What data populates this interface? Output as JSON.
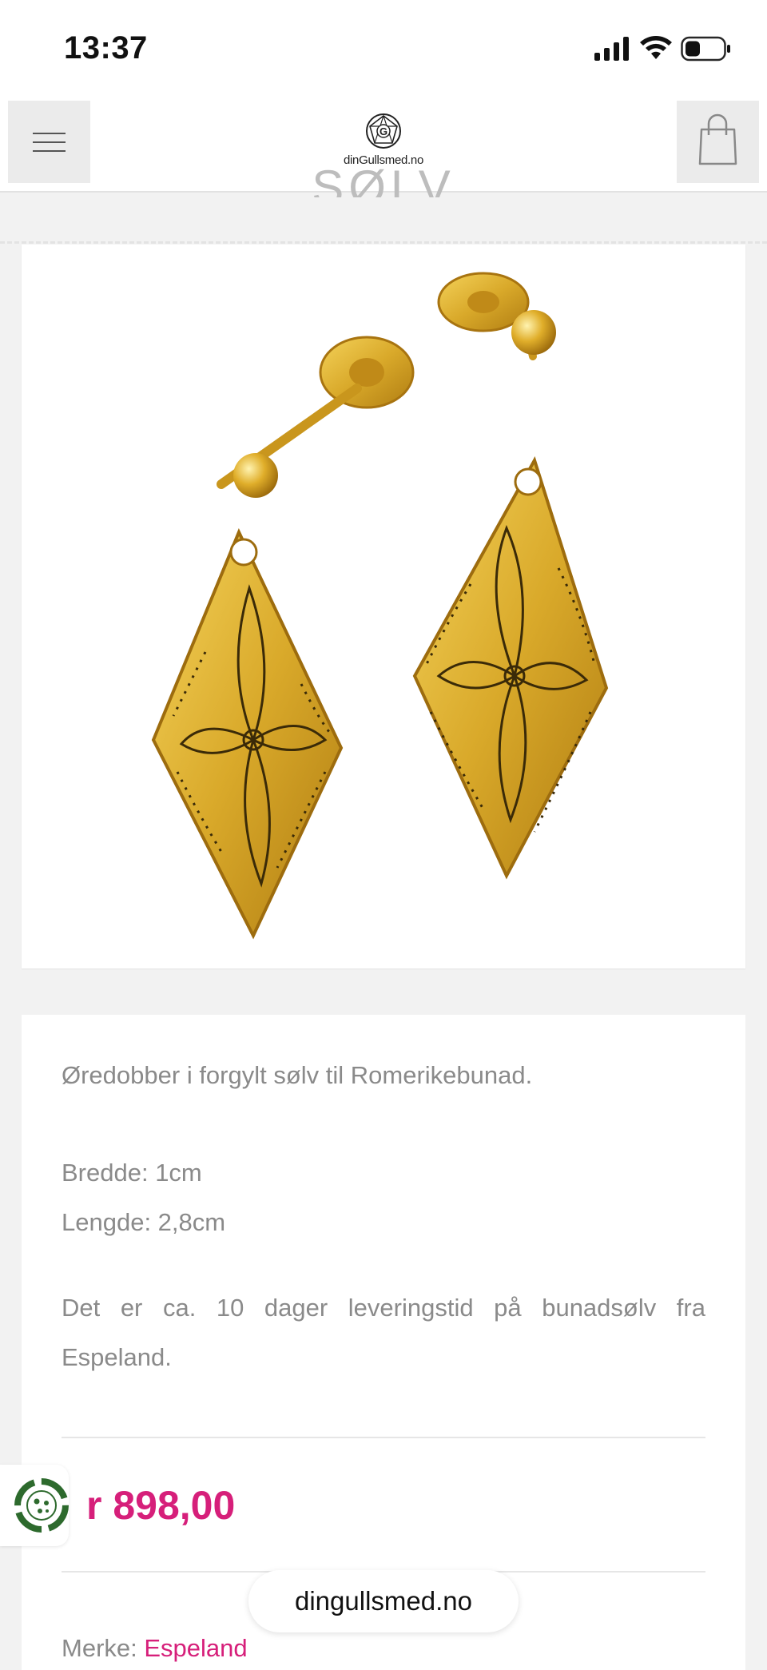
{
  "status_bar": {
    "time": "13:37"
  },
  "header": {
    "logo_text": "dinGullsmed.no",
    "menu_icon": "hamburger-menu-icon",
    "cart_icon": "shopping-bag-icon"
  },
  "page": {
    "title_partial": "SØLV"
  },
  "product": {
    "image_alt": "Gold earrings",
    "description": "Øredobber i forgylt sølv til Romerikebunad.",
    "width": "Bredde: 1cm",
    "length": "Lengde: 2,8cm",
    "delivery": "Det er ca. 10 dager leveringstid på bunadsølv fra Espeland.",
    "price": "r 898,00",
    "brand_label": "Merke: ",
    "brand": "Espeland"
  },
  "browser": {
    "url": "dingullsmed.no"
  },
  "colors": {
    "accent": "#d61f7a",
    "gold": "#d9a92a"
  }
}
